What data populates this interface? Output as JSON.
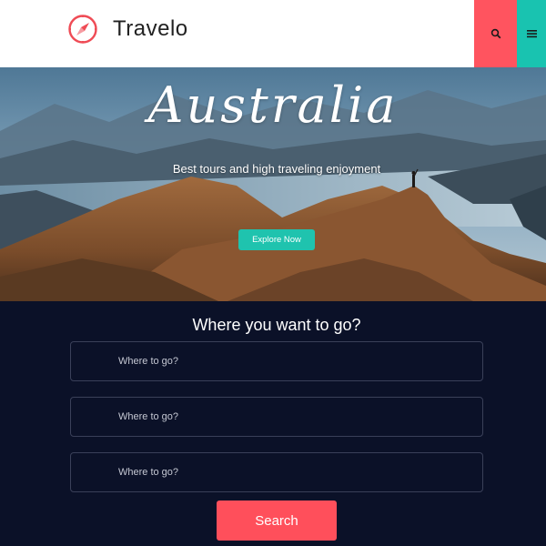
{
  "header": {
    "brand_name": "Travelo",
    "logo_icon": "compass-icon",
    "search_icon": "search-icon",
    "menu_icon": "hamburger-menu-icon",
    "colors": {
      "search_button": "#ff545f",
      "menu_button": "#19c3b0",
      "logo": "#ef4b55"
    }
  },
  "hero": {
    "title": "Australia",
    "subtitle": "Best tours and high traveling enjoyment",
    "explore_button": "Explore Now",
    "colors": {
      "explore_button": "#1fc3ae"
    }
  },
  "search": {
    "title": "Where you want to go?",
    "fields": [
      {
        "placeholder": "Where to go?"
      },
      {
        "placeholder": "Where to go?"
      },
      {
        "placeholder": "Where to go?"
      }
    ],
    "submit_label": "Search",
    "colors": {
      "background": "#0b1128",
      "submit": "#ff4f5b"
    }
  }
}
